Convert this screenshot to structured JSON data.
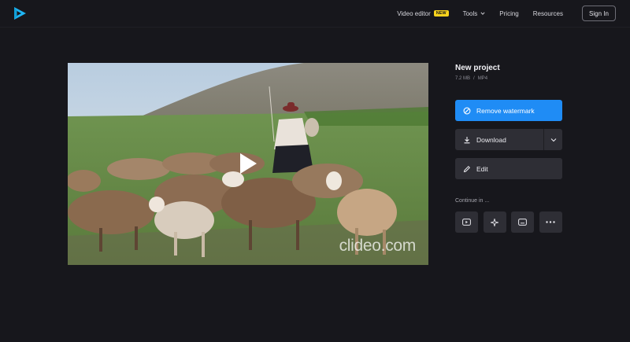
{
  "header": {
    "logo_icon": "play-triangle-logo-icon",
    "nav": {
      "video_editor": "Video editor",
      "new_badge": "NEW",
      "tools": "Tools",
      "pricing": "Pricing",
      "resources": "Resources"
    },
    "sign_in": "Sign In"
  },
  "video": {
    "watermark": "clideo.com",
    "play_icon": "play-icon"
  },
  "project": {
    "title": "New project",
    "size": "7.2 MB",
    "separator": "/",
    "format": "MP4"
  },
  "actions": {
    "remove_watermark": "Remove watermark",
    "download": "Download",
    "edit": "Edit"
  },
  "continue": {
    "label": "Continue in ...",
    "tools": [
      "youtube-icon",
      "sparkle-icon",
      "subtitles-icon",
      "more-icon"
    ]
  },
  "colors": {
    "background": "#17171c",
    "primary": "#1f8cf5",
    "badge": "#f7d21d",
    "button_dark": "#2e2e35"
  }
}
